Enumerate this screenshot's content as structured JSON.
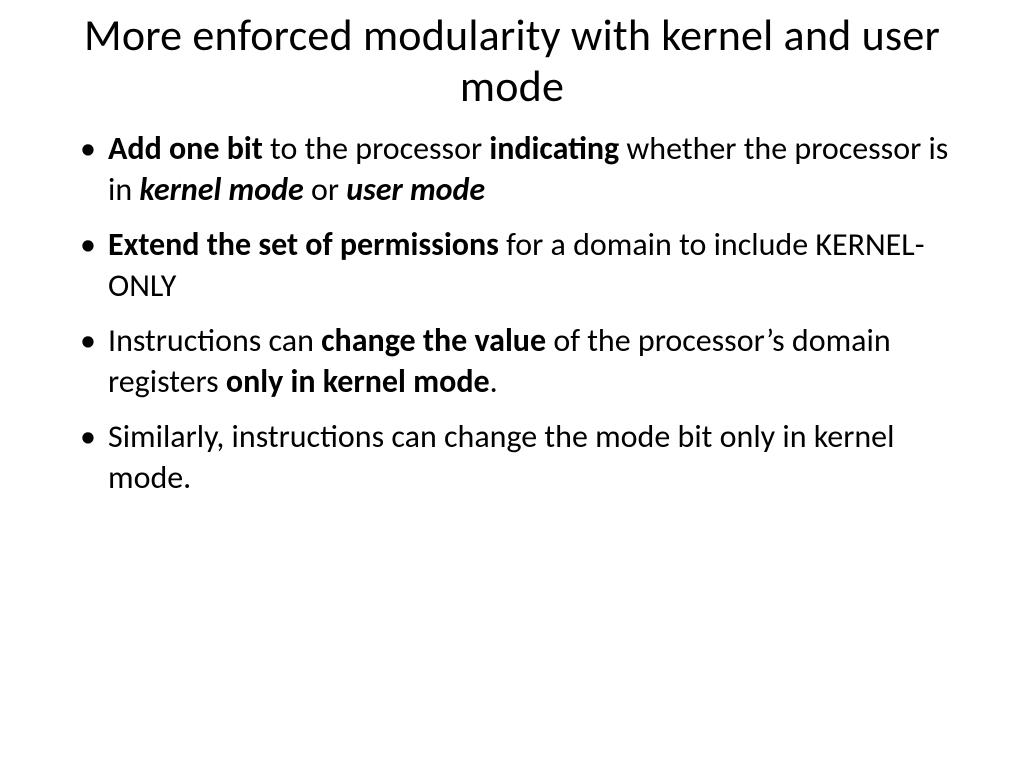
{
  "title": "More enforced modularity with kernel and user mode",
  "bullet1": {
    "s1": "Add one bit ",
    "s2": "to the processor ",
    "s3": "indicating",
    "s4": " whether the processor is in ",
    "s5": "kernel mode",
    "s6": " or ",
    "s7": "user mode"
  },
  "bullet2": {
    "s1": "Extend the set of permissions ",
    "s2": "for a domain to include KERNEL-ONLY"
  },
  "bullet3": {
    "s1": "Instructions can ",
    "s2": "change the value ",
    "s3": "of the processor’s domain registers ",
    "s4": "only in kernel mode",
    "s5": "."
  },
  "bullet4": {
    "s1": "Similarly, instructions can change the mode bit only in kernel mode."
  }
}
